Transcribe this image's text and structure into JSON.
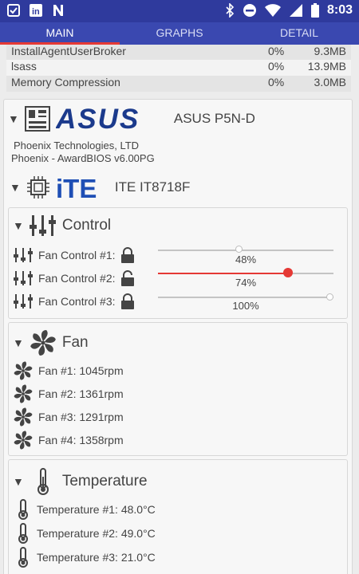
{
  "statusbar": {
    "time": "8:03"
  },
  "tabs": [
    {
      "label": "MAIN",
      "active": true
    },
    {
      "label": "GRAPHS",
      "active": false
    },
    {
      "label": "DETAIL",
      "active": false
    }
  ],
  "processes": [
    {
      "name": "InstallAgentUserBroker",
      "pct": "0%",
      "mem": "9.3MB"
    },
    {
      "name": "lsass",
      "pct": "0%",
      "mem": "13.9MB"
    },
    {
      "name": "Memory Compression",
      "pct": "0%",
      "mem": "3.0MB"
    }
  ],
  "mobo": {
    "brand_text": "ASUS",
    "model": "ASUS P5N-D",
    "bios_vendor": "Phoenix Technologies, LTD",
    "bios_version": "Phoenix - AwardBIOS v6.00PG"
  },
  "chip": {
    "brand_text": "iTE",
    "name": "ITE IT8718F"
  },
  "control": {
    "title": "Control",
    "items": [
      {
        "label": "Fan Control #1:",
        "value": "48%",
        "level": 48,
        "locked": true
      },
      {
        "label": "Fan Control #2:",
        "value": "74%",
        "level": 74,
        "locked": false
      },
      {
        "label": "Fan Control #3:",
        "value": "100%",
        "level": 100,
        "locked": true
      }
    ]
  },
  "fan": {
    "title": "Fan",
    "items": [
      "Fan #1: 1045rpm",
      "Fan #2: 1361rpm",
      "Fan #3: 1291rpm",
      "Fan #4: 1358rpm"
    ]
  },
  "temperature": {
    "title": "Temperature",
    "items": [
      "Temperature #1: 48.0°C",
      "Temperature #2: 49.0°C",
      "Temperature #3: 21.0°C"
    ]
  },
  "colors": {
    "primary": "#3a48b0",
    "statusbar": "#2f3a9d",
    "accent": "#e53935",
    "asus_blue": "#1b3a8c"
  }
}
